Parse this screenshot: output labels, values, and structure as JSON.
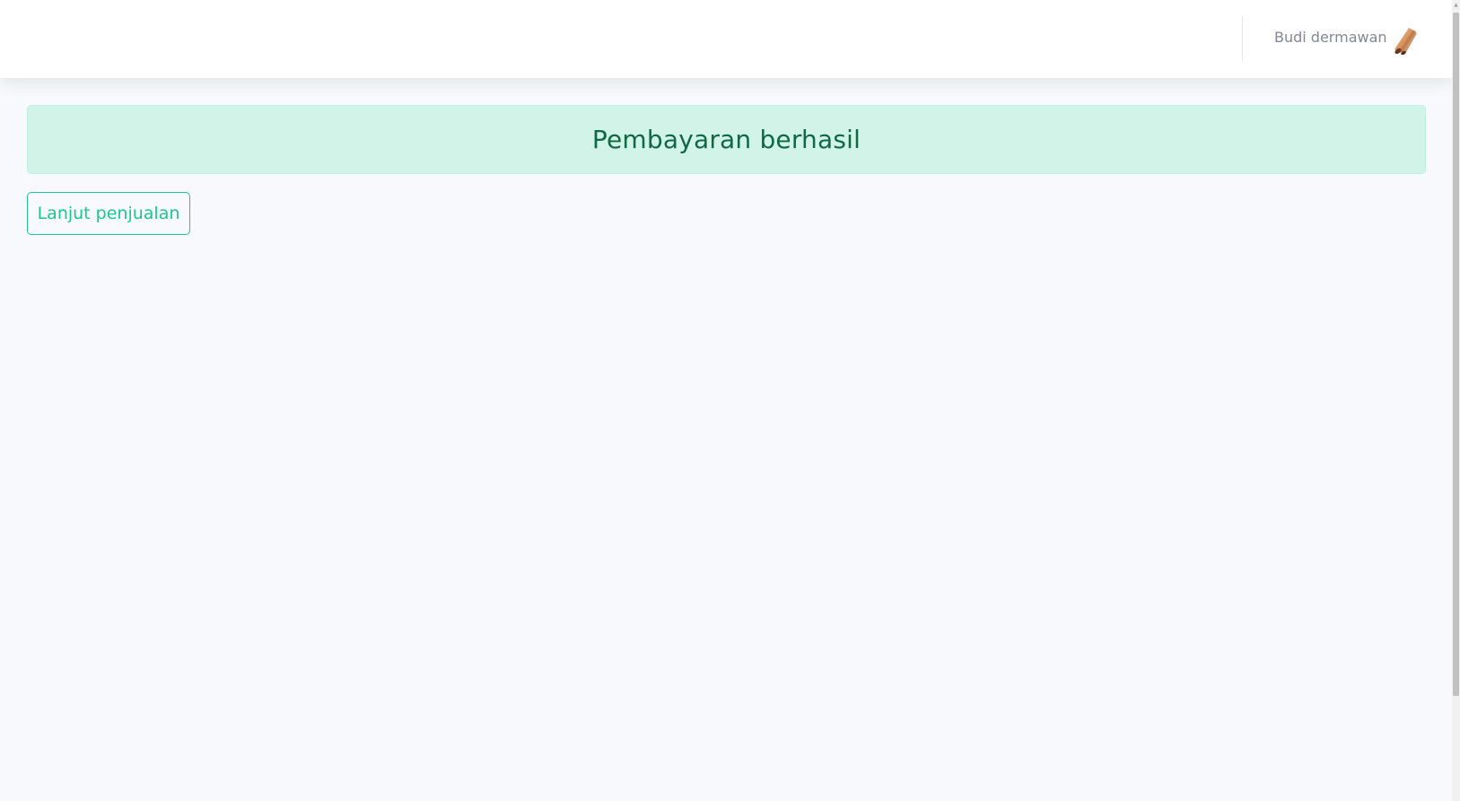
{
  "header": {
    "user_name": "Budi dermawan",
    "avatar_icon": "avatar-icon"
  },
  "main": {
    "alert_message": "Pembayaran berhasil",
    "continue_button_label": "Lanjut penjualan"
  },
  "colors": {
    "success": "#1cc88a",
    "success_bg": "#d2f4e8",
    "success_text": "#0f6848",
    "page_bg": "#f8f9fc",
    "muted_text": "#858796"
  }
}
